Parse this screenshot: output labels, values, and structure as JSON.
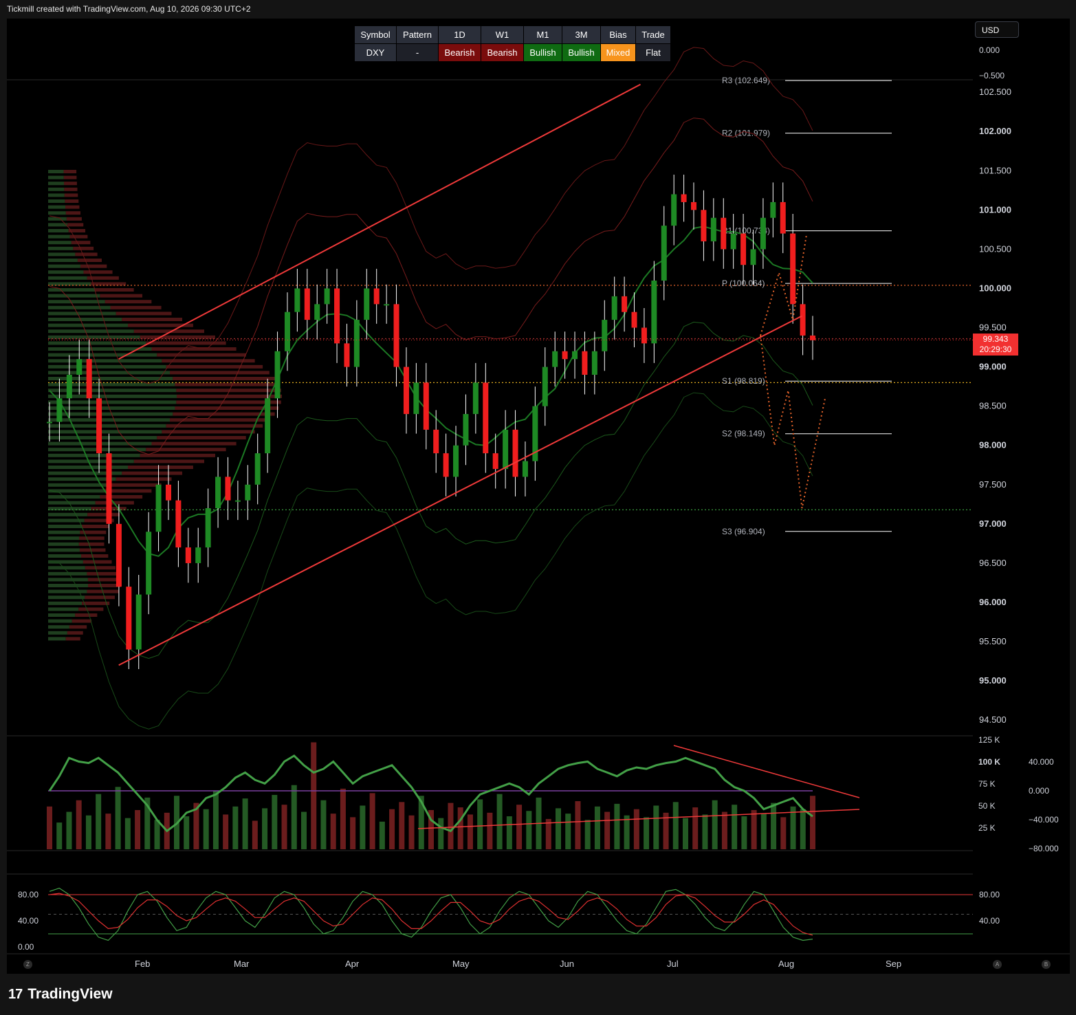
{
  "header": {
    "title": "Tickmill created with TradingView.com, Aug 10, 2026 09:30 UTC+2"
  },
  "footer": {
    "brand": "TradingView"
  },
  "currency_button": "USD",
  "price_label": {
    "price": "99.343",
    "countdown": "20:29:30"
  },
  "bias_table": {
    "headers": [
      "Symbol",
      "Pattern",
      "1D",
      "W1",
      "M1",
      "3M",
      "Bias",
      "Trade"
    ],
    "values": [
      "DXY",
      "-",
      "Bearish",
      "Bearish",
      "Bullish",
      "Bullish",
      "Mixed",
      "Flat"
    ],
    "colors": [
      "#2a2e39",
      "#1e2028",
      "#7a0c0c",
      "#7a0c0c",
      "#0f6b12",
      "#0f6b12",
      "#f7941d",
      "#1e2028"
    ]
  },
  "colors": {
    "up": "#1e8a24",
    "down": "#f01e1e",
    "channel": "#f03a3a",
    "forecast": "#e8642a",
    "pivot": "#ffffff"
  },
  "scale_buttons": {
    "left": "Z",
    "a": "A",
    "b": "B"
  },
  "chart_data": [
    {
      "type": "candlestick",
      "symbol": "DXY",
      "x_ticks": [
        "Feb",
        "Mar",
        "Apr",
        "May",
        "Jun",
        "Jul",
        "Aug",
        "Sep"
      ],
      "y_ticks": [
        "102.500",
        "102.000",
        "101.500",
        "101.000",
        "100.500",
        "100.000",
        "99.500",
        "99.000",
        "98.500",
        "98.000",
        "97.500",
        "97.000",
        "96.500",
        "96.000",
        "95.500",
        "95.000",
        "94.500"
      ],
      "top_pane_ticks": [
        "0.000",
        "−0.500"
      ],
      "ylim": [
        94.3,
        102.65
      ],
      "close_series": [
        98.3,
        98.6,
        98.9,
        99.1,
        98.6,
        97.9,
        97.0,
        96.2,
        95.4,
        96.1,
        96.9,
        97.5,
        97.3,
        96.7,
        96.5,
        96.7,
        97.2,
        97.6,
        97.3,
        97.3,
        97.5,
        97.9,
        98.6,
        99.2,
        99.7,
        100.0,
        99.6,
        99.8,
        100.0,
        99.3,
        99.0,
        99.6,
        100.0,
        99.8,
        99.8,
        99.0,
        98.4,
        98.8,
        98.2,
        97.9,
        97.6,
        98.0,
        98.4,
        98.8,
        97.9,
        97.7,
        98.2,
        97.6,
        97.8,
        98.5,
        99.0,
        99.2,
        99.1,
        99.2,
        98.9,
        99.2,
        99.6,
        99.9,
        99.7,
        99.5,
        99.3,
        100.1,
        100.8,
        101.2,
        101.1,
        101.0,
        100.6,
        100.9,
        100.5,
        100.7,
        100.3,
        100.5,
        100.9,
        101.1,
        100.7,
        99.8,
        99.4,
        99.34
      ],
      "last_price": 99.343,
      "pivot_levels": [
        {
          "name": "R3 (102.649)",
          "value": 102.649
        },
        {
          "name": "R2 (101.979)",
          "value": 101.979
        },
        {
          "name": "R1 (100.734)",
          "value": 100.734
        },
        {
          "name": "P (100.064)",
          "value": 100.064
        },
        {
          "name": "S1 (98.819)",
          "value": 98.819
        },
        {
          "name": "S2 (98.149)",
          "value": 98.149
        },
        {
          "name": "S3 (96.904)",
          "value": 96.904
        }
      ],
      "horizontal_levels": [
        100.04,
        99.36,
        98.8,
        97.18
      ],
      "channel": {
        "upper": [
          [
            0.075,
            99.1
          ],
          [
            0.64,
            102.6
          ]
        ],
        "lower": [
          [
            0.075,
            95.2
          ],
          [
            0.815,
            99.65
          ]
        ]
      },
      "forecast_paths": [
        [
          [
            0.77,
            99.4
          ],
          [
            0.79,
            100.2
          ],
          [
            0.805,
            99.6
          ],
          [
            0.82,
            100.7
          ]
        ],
        [
          [
            0.77,
            99.4
          ],
          [
            0.785,
            98.0
          ],
          [
            0.8,
            98.7
          ],
          [
            0.815,
            97.2
          ],
          [
            0.84,
            98.6
          ]
        ]
      ]
    },
    {
      "type": "line",
      "name": "volume + oscillator",
      "y_ticks_volume": [
        "125 K",
        "100 K",
        "75 K",
        "50 K",
        "25 K"
      ],
      "y_ticks_osc": [
        "40.000",
        "0.000",
        "−40.000",
        "−80.000"
      ],
      "osc_ylim": [
        -80,
        80
      ],
      "osc_series": [
        0,
        20,
        45,
        40,
        38,
        45,
        35,
        25,
        10,
        -5,
        -20,
        -40,
        -55,
        -45,
        -30,
        -25,
        -10,
        -5,
        5,
        18,
        25,
        15,
        10,
        22,
        40,
        48,
        35,
        25,
        30,
        40,
        25,
        10,
        20,
        25,
        30,
        35,
        20,
        5,
        -15,
        -40,
        -50,
        -55,
        -40,
        -20,
        -5,
        0,
        5,
        10,
        5,
        -5,
        10,
        20,
        30,
        35,
        38,
        40,
        30,
        25,
        20,
        28,
        32,
        30,
        35,
        38,
        40,
        45,
        40,
        35,
        30,
        15,
        5,
        0,
        -10,
        -25,
        -20,
        -15,
        -10,
        -25,
        -35
      ],
      "volume_series": [
        48,
        30,
        42,
        55,
        38,
        62,
        40,
        70,
        35,
        44,
        58,
        33,
        41,
        60,
        37,
        52,
        45,
        66,
        39,
        48,
        57,
        32,
        46,
        61,
        50,
        72,
        42,
        120,
        55,
        40,
        68,
        36,
        49,
        63,
        31,
        45,
        53,
        38,
        60,
        44,
        35,
        52,
        47,
        39,
        56,
        41,
        62,
        37,
        50,
        43,
        58,
        34,
        46,
        40,
        54,
        33,
        48,
        42,
        51,
        38,
        45,
        36,
        49,
        41,
        53,
        35,
        47,
        39,
        55,
        42,
        50,
        37,
        44,
        40,
        52,
        36,
        48,
        45,
        60
      ]
    },
    {
      "type": "line",
      "name": "stochastic",
      "y_ticks": [
        "80.00",
        "40.00",
        "0.00"
      ],
      "right_ticks": [
        "80.00",
        "40.00"
      ],
      "ylim": [
        0,
        100
      ],
      "levels": [
        80,
        50,
        20
      ],
      "k_series": [
        85,
        90,
        80,
        60,
        35,
        15,
        10,
        25,
        55,
        80,
        85,
        70,
        45,
        25,
        30,
        55,
        75,
        85,
        80,
        60,
        40,
        30,
        50,
        75,
        85,
        80,
        60,
        35,
        20,
        25,
        45,
        70,
        85,
        80,
        65,
        40,
        20,
        15,
        30,
        55,
        75,
        80,
        60,
        35,
        20,
        30,
        55,
        75,
        85,
        80,
        60,
        40,
        30,
        45,
        70,
        85,
        80,
        60,
        40,
        25,
        20,
        35,
        60,
        85,
        88,
        80,
        65,
        45,
        30,
        25,
        40,
        65,
        85,
        80,
        55,
        30,
        15,
        10,
        12
      ],
      "d_series": [
        80,
        82,
        78,
        70,
        55,
        40,
        28,
        30,
        42,
        60,
        72,
        72,
        62,
        48,
        40,
        45,
        58,
        70,
        75,
        70,
        58,
        45,
        45,
        58,
        70,
        75,
        70,
        55,
        40,
        32,
        35,
        50,
        65,
        75,
        72,
        58,
        40,
        28,
        28,
        40,
        55,
        68,
        68,
        55,
        40,
        35,
        42,
        58,
        70,
        75,
        70,
        58,
        45,
        42,
        55,
        70,
        75,
        70,
        58,
        42,
        32,
        32,
        45,
        65,
        78,
        80,
        75,
        62,
        48,
        38,
        38,
        50,
        65,
        72,
        65,
        48,
        32,
        22,
        18
      ]
    }
  ]
}
